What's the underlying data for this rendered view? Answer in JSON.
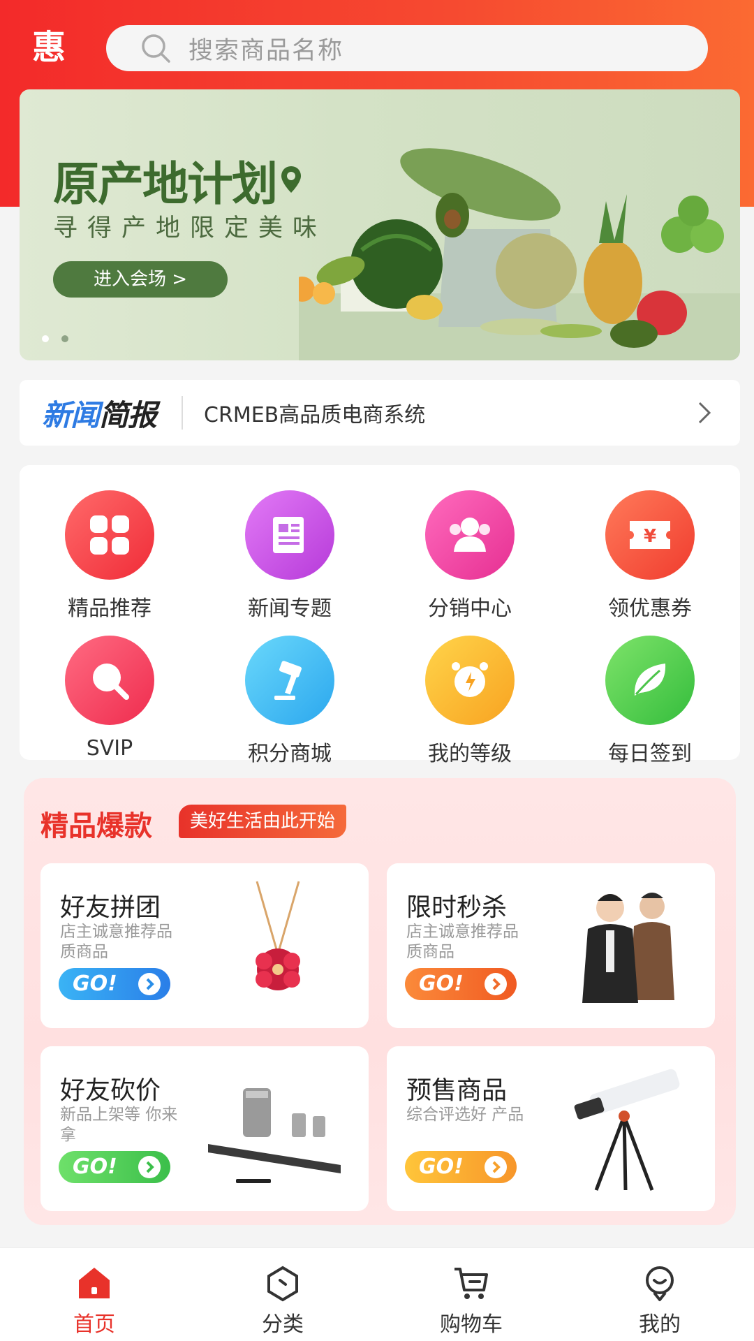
{
  "header": {
    "logo_char": "惠",
    "search_placeholder": "搜索商品名称"
  },
  "banner": {
    "title": "原产地计划",
    "subtitle": "寻得产地限定美味",
    "button": "进入会场 >",
    "active_slide": 1,
    "slide_count": 2
  },
  "news": {
    "logo_a": "新闻",
    "logo_b": "简报",
    "headline": "CRMEB高品质电商系统"
  },
  "menu": [
    {
      "label": "精品推荐",
      "icon": "grid-icon",
      "colors": [
        "#ff6a6a",
        "#f02c38"
      ]
    },
    {
      "label": "新闻专题",
      "icon": "document-icon",
      "colors": [
        "#e27af6",
        "#b63ad9"
      ]
    },
    {
      "label": "分销中心",
      "icon": "users-icon",
      "colors": [
        "#ff6bbd",
        "#e62f92"
      ]
    },
    {
      "label": "领优惠券",
      "icon": "coupon-icon",
      "colors": [
        "#ff7a5a",
        "#f03c2e"
      ]
    },
    {
      "label": "SVIP",
      "icon": "magnifier-icon",
      "colors": [
        "#ff6b82",
        "#ef2c4e"
      ]
    },
    {
      "label": "积分商城",
      "icon": "gavel-icon",
      "colors": [
        "#6ad8fb",
        "#2ba7ee"
      ]
    },
    {
      "label": "我的等级",
      "icon": "alarm-icon",
      "colors": [
        "#ffd44a",
        "#f8a321"
      ]
    },
    {
      "label": "每日签到",
      "icon": "leaf-icon",
      "colors": [
        "#7ee36a",
        "#34bd3c"
      ]
    }
  ],
  "hot": {
    "title": "精品爆款",
    "tag": "美好生活由此开始",
    "cards": [
      {
        "title": "好友拼团",
        "subtitle": "店主诚意推荐品质商品",
        "go": "GO!",
        "colors": [
          "#3ab3f5",
          "#2a7ee8"
        ],
        "art": "necklace-image"
      },
      {
        "title": "限时秒杀",
        "subtitle": "店主诚意推荐品质商品",
        "go": "GO!",
        "colors": [
          "#fb8a3a",
          "#f05a22"
        ],
        "art": "jackets-image"
      },
      {
        "title": "好友砍价",
        "subtitle": "新品上架等 你来拿",
        "go": "GO!",
        "colors": [
          "#6ee06a",
          "#3bbf4a"
        ],
        "art": "speaker-image"
      },
      {
        "title": "预售商品",
        "subtitle": "综合评选好 产品",
        "go": "GO!",
        "colors": [
          "#ffc53a",
          "#f7962a"
        ],
        "art": "telescope-image"
      }
    ]
  },
  "tabs": [
    {
      "label": "首页",
      "icon": "home-icon",
      "active": true
    },
    {
      "label": "分类",
      "icon": "category-icon",
      "active": false
    },
    {
      "label": "购物车",
      "icon": "cart-icon",
      "active": false
    },
    {
      "label": "我的",
      "icon": "profile-icon",
      "active": false
    }
  ],
  "colors": {
    "accent": "#e8322a",
    "tab_inactive": "#333333"
  }
}
